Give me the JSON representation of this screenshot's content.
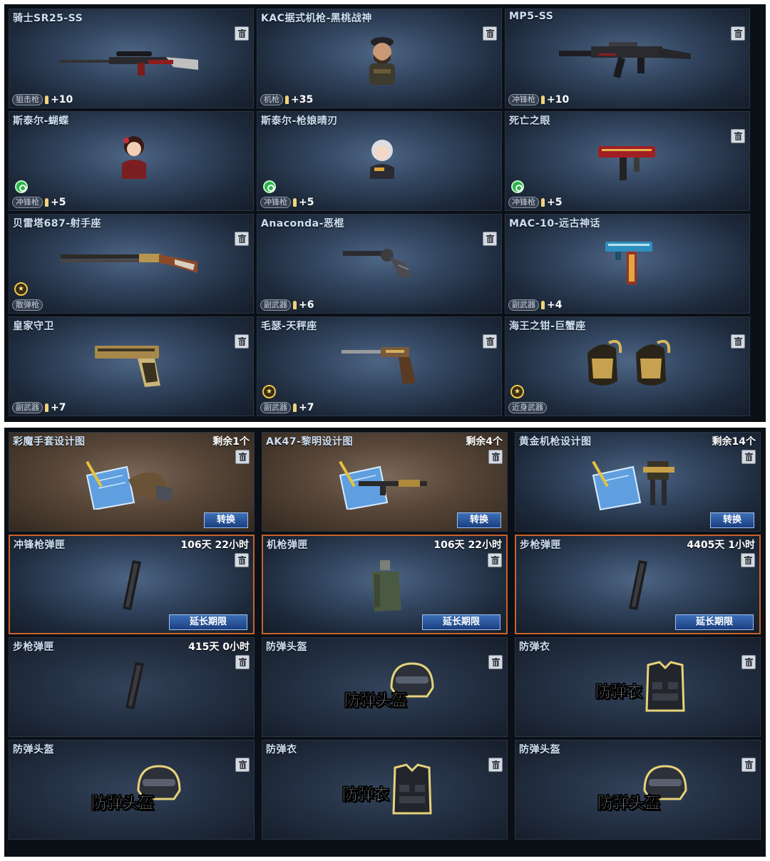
{
  "inventory": [
    {
      "name": "骑士SR25-SS",
      "category": "狙击枪",
      "bonus": "+10",
      "trash": true,
      "icon": "sniper-rifle-icon"
    },
    {
      "name": "KAC据式机枪-黑桃战神",
      "category": "机枪",
      "bonus": "+35",
      "trash": true,
      "icon": "soldier-character-icon"
    },
    {
      "name": "MP5-SS",
      "category": "冲锋枪",
      "bonus": "+10",
      "trash": true,
      "icon": "smg-icon"
    },
    {
      "name": "斯泰尔-蝴蝶",
      "category": "冲锋枪",
      "bonus": "+5",
      "trash": false,
      "badge": "green",
      "icon": "female-character-icon"
    },
    {
      "name": "斯泰尔-枪娘晴刃",
      "category": "冲锋枪",
      "bonus": "+5",
      "trash": false,
      "badge": "green",
      "icon": "female-character-icon"
    },
    {
      "name": "死亡之眼",
      "category": "冲锋枪",
      "bonus": "+5",
      "trash": true,
      "badge": "green",
      "icon": "red-smg-icon"
    },
    {
      "name": "贝雷塔687-射手座",
      "category": "散弹枪",
      "bonus": "",
      "trash": true,
      "badge": "gold",
      "icon": "shotgun-icon"
    },
    {
      "name": "Anaconda-恶棍",
      "category": "副武器",
      "bonus": "+6",
      "trash": true,
      "icon": "revolver-icon"
    },
    {
      "name": "MAC-10-远古神话",
      "category": "副武器",
      "bonus": "+4",
      "trash": false,
      "icon": "mac10-icon"
    },
    {
      "name": "皇家守卫",
      "category": "副武器",
      "bonus": "+7",
      "trash": true,
      "icon": "pistol-icon"
    },
    {
      "name": "毛瑟-天秤座",
      "category": "副武器",
      "bonus": "+7",
      "trash": true,
      "badge": "gold",
      "icon": "mauser-icon"
    },
    {
      "name": "海王之钳-巨蟹座",
      "category": "近身武器",
      "bonus": "",
      "trash": true,
      "badge": "gold",
      "icon": "claw-gauntlet-icon"
    }
  ],
  "items": [
    {
      "name": "彩魔手套设计图",
      "right": "剩余1个",
      "button": "转换",
      "style": "brown",
      "icon": "blueprint-glove-icon"
    },
    {
      "name": "AK47-黎明设计图",
      "right": "剩余4个",
      "button": "转换",
      "style": "brown",
      "icon": "blueprint-rifle-icon"
    },
    {
      "name": "黄金机枪设计图",
      "right": "剩余14个",
      "button": "转换",
      "style": "blue",
      "icon": "blueprint-mech-icon"
    },
    {
      "name": "冲锋枪弹匣",
      "right": "106天 22小时",
      "button": "延长期限",
      "style": "expire",
      "icon": "magazine-icon"
    },
    {
      "name": "机枪弹匣",
      "right": "106天 22小时",
      "button": "延长期限",
      "style": "expire",
      "icon": "ammo-box-icon"
    },
    {
      "name": "步枪弹匣",
      "right": "4405天 1小时",
      "button": "延长期限",
      "style": "expire",
      "icon": "magazine-icon"
    },
    {
      "name": "步枪弹匣",
      "right": "415天 0小时",
      "button": "",
      "style": "dark",
      "icon": "magazine-icon"
    },
    {
      "name": "防弹头盔",
      "right": "",
      "button": "",
      "style": "dark",
      "icon": "helmet-icon",
      "overlay": "防弹头盔"
    },
    {
      "name": "防弹衣",
      "right": "",
      "button": "",
      "style": "dark",
      "icon": "vest-icon",
      "overlay": "防弹衣"
    },
    {
      "name": "防弹头盔",
      "right": "",
      "button": "",
      "style": "dark",
      "icon": "helmet-icon",
      "overlay": "防弹头盔"
    },
    {
      "name": "防弹衣",
      "right": "",
      "button": "",
      "style": "dark",
      "icon": "vest-icon",
      "overlay": "防弹衣"
    },
    {
      "name": "防弹头盔",
      "right": "",
      "button": "",
      "style": "dark",
      "icon": "helmet-icon",
      "overlay": "防弹头盔"
    }
  ]
}
